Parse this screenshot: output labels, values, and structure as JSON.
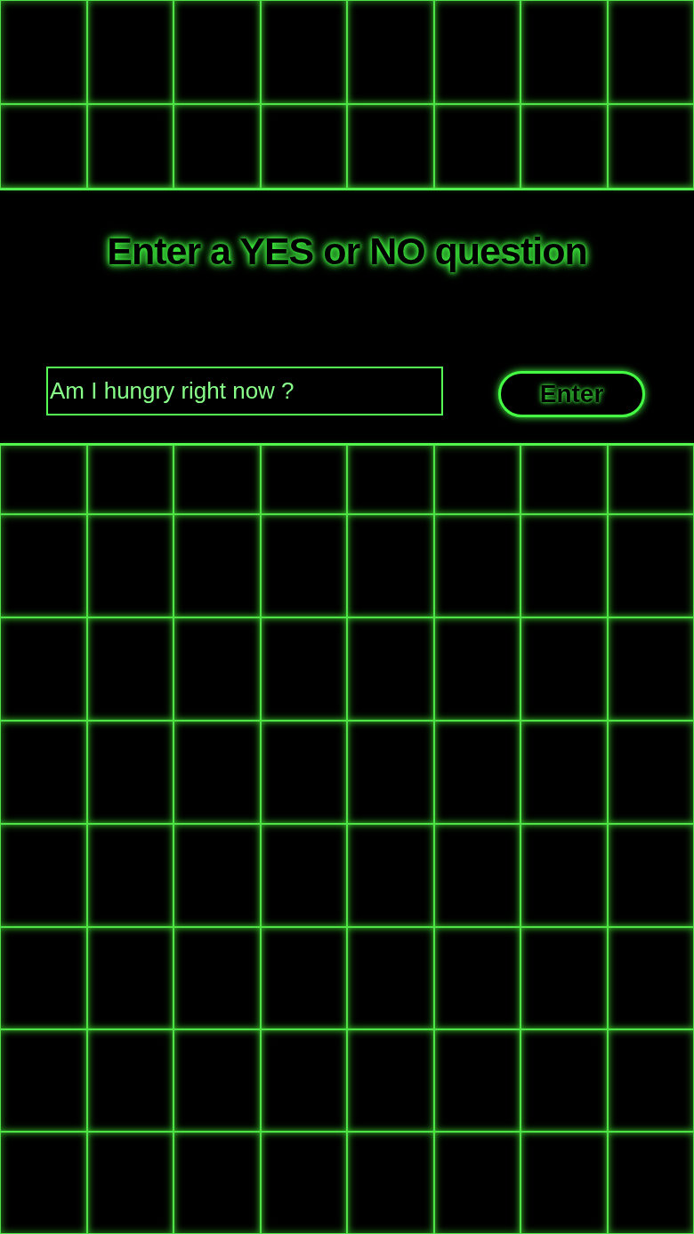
{
  "title": "Enter a YES or NO question",
  "question_field": {
    "value": "Am I hungry right now ?"
  },
  "enter_button": {
    "label": "Enter"
  }
}
